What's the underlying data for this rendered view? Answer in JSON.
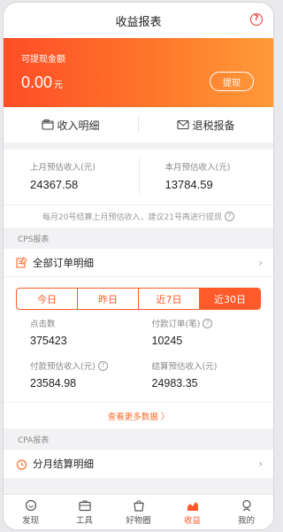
{
  "header": {
    "title": "收益报表",
    "help_glyph": "?"
  },
  "balance": {
    "label": "可提现金额",
    "amount": "0.00",
    "unit": "元",
    "withdraw_label": "提现"
  },
  "quick_actions": [
    {
      "label": "收入明细",
      "icon": "receipt-icon"
    },
    {
      "label": "退税报备",
      "icon": "mail-icon"
    }
  ],
  "estimates": {
    "last_month_label": "上月预估收入(元)",
    "last_month_value": "24367.58",
    "this_month_label": "本月预估收入(元)",
    "this_month_value": "13784.59"
  },
  "notice": {
    "text": "每月20号结算上月预估收入，建议21号再进行提现",
    "glyph": "?"
  },
  "cps": {
    "section_label": "CPS报表",
    "all_orders_label": "全部订单明细",
    "tabs": [
      "今日",
      "昨日",
      "近7日",
      "近30日"
    ],
    "active_tab": 3,
    "stats": {
      "clicks_label": "点击数",
      "clicks_value": "375423",
      "paid_orders_label": "付款订单(笔)",
      "paid_orders_value": "10245",
      "paid_income_label": "付款预估收入(元)",
      "paid_income_value": "23584.98",
      "settled_income_label": "结算预估收入(元)",
      "settled_income_value": "24983.35"
    },
    "more_label": "查看更多数据 〉",
    "q_glyph": "?"
  },
  "cpa": {
    "section_label": "CPA报表",
    "monthly_label": "分月结算明细"
  },
  "nav": [
    {
      "label": "发现",
      "icon": "discover-icon"
    },
    {
      "label": "工具",
      "icon": "toolbox-icon"
    },
    {
      "label": "好物圈",
      "icon": "bag-icon"
    },
    {
      "label": "收益",
      "icon": "earnings-icon"
    },
    {
      "label": "我的",
      "icon": "profile-icon"
    }
  ],
  "nav_active_index": 3,
  "colors": {
    "accent": "#ff5a2a",
    "banner_start": "#ff4d26",
    "banner_end": "#ff9a3a"
  }
}
